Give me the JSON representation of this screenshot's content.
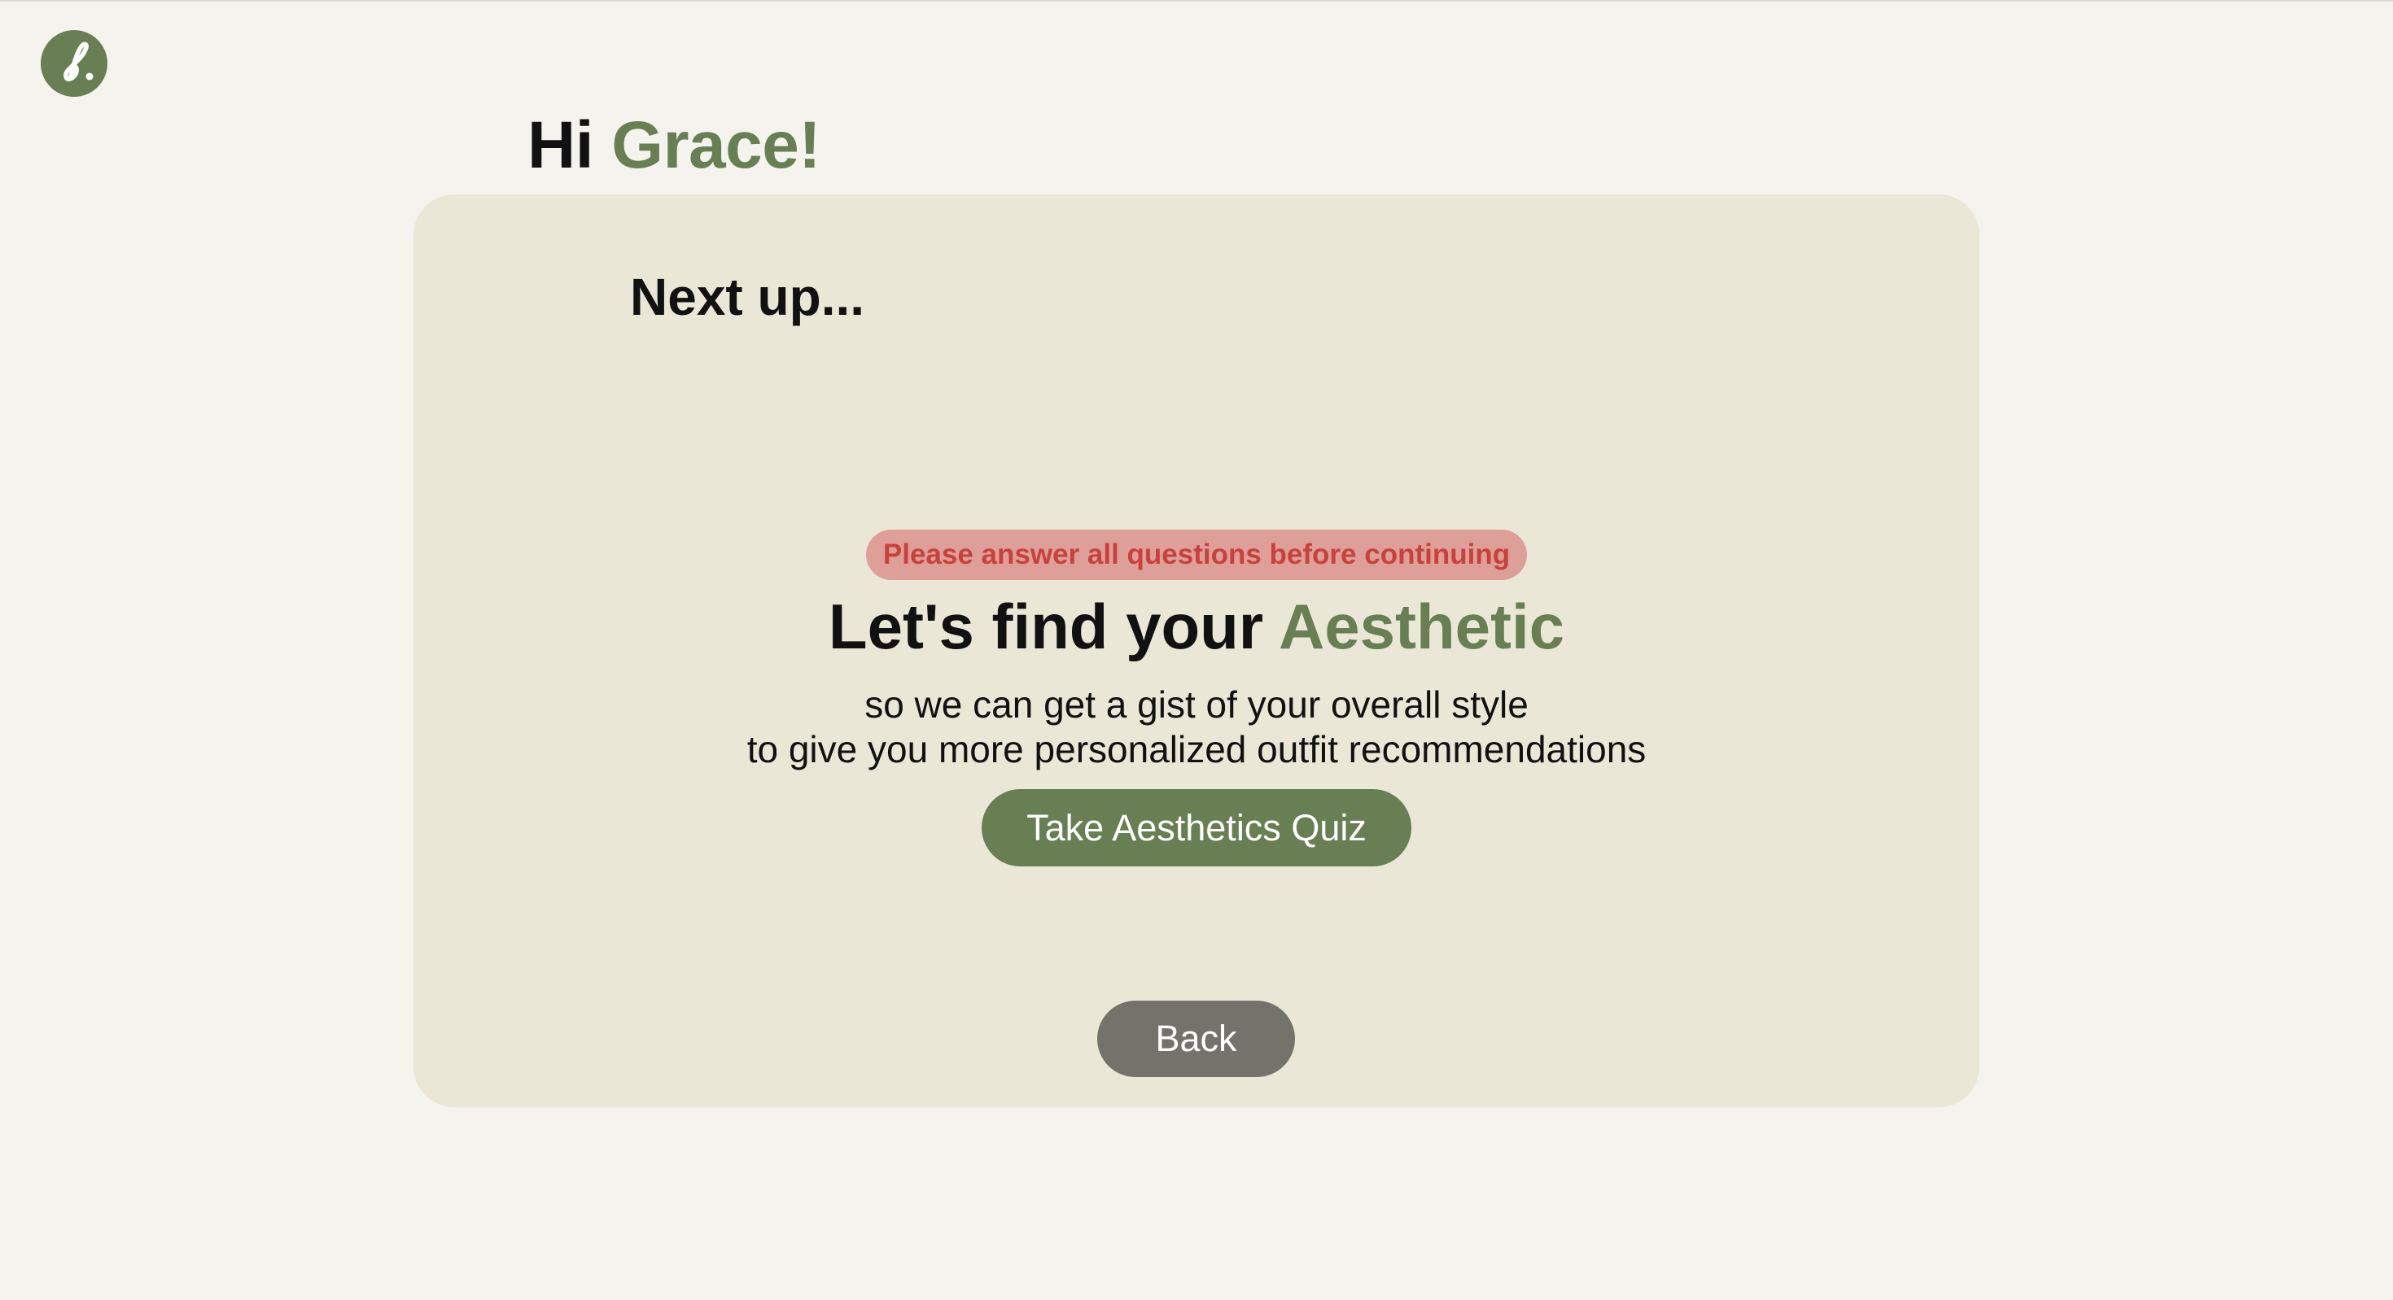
{
  "app": {
    "logo_icon": "cursive-f-logo-icon",
    "colors": {
      "accent": "#677f52",
      "background": "#f4f3ee",
      "card": "#eae7d7",
      "warning_bg": "#de9f98",
      "warning_text": "#c8423c",
      "back_button": "#73736b"
    }
  },
  "header": {
    "greeting_prefix": "Hi",
    "user_name": "Grace!"
  },
  "card": {
    "section_title": "Next up...",
    "warning": "Please answer all questions before continuing",
    "headline_prefix": "Let's find your",
    "headline_accent": "Aesthetic",
    "subtitle_line1": "so we can get a gist of your overall style",
    "subtitle_line2": "to give you more personalized outfit recommendations",
    "quiz_button": "Take Aesthetics Quiz",
    "back_button": "Back"
  }
}
